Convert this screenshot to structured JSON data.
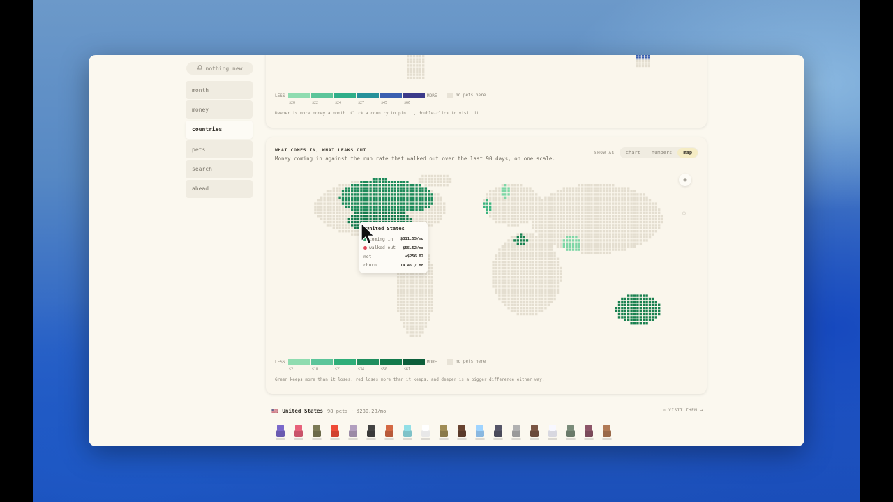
{
  "sidebar": {
    "notice": "nothing new",
    "items": [
      {
        "label": "month"
      },
      {
        "label": "money"
      },
      {
        "label": "countries",
        "active": true
      },
      {
        "label": "pets"
      },
      {
        "label": "search"
      },
      {
        "label": "ahead"
      }
    ]
  },
  "top_card": {
    "legend": {
      "less": "LESS",
      "more": "MORE",
      "colors": [
        "#8fdcb0",
        "#5cc59a",
        "#2fae89",
        "#26919a",
        "#3a5fb0",
        "#3b3a8a"
      ],
      "values": [
        "$20",
        "$22",
        "$24",
        "$27",
        "$45",
        "$66"
      ],
      "none_label": "no pets here"
    },
    "note": "Deeper is more money a month. Click a country to pin it, double-click to visit it."
  },
  "main_card": {
    "title": "WHAT COMES IN, WHAT LEAKS OUT",
    "subtitle": "Money coming in against the run rate that walked out over the last 90 days, on one scale.",
    "show_as_label": "SHOW AS",
    "views": [
      {
        "label": "chart"
      },
      {
        "label": "numbers"
      },
      {
        "label": "map",
        "selected": true
      }
    ],
    "zoom_in": "+",
    "zoom_out": "−",
    "zoom_reset": "○",
    "tooltip": {
      "country": "United States",
      "rows": [
        {
          "label": "coming in",
          "value": "$311.55/mo",
          "dot": "#2f9e6b"
        },
        {
          "label": "walked out",
          "value": "$55.52/mo",
          "dot": "#e0485a"
        },
        {
          "label": "net",
          "value": "+$256.02",
          "dot": ""
        },
        {
          "label": "churn",
          "value": "14.4% / mo",
          "dot": ""
        }
      ]
    },
    "legend": {
      "less": "LESS",
      "more": "MORE",
      "colors": [
        "#8fdcb0",
        "#5cc59a",
        "#2fae79",
        "#1f8e5e",
        "#137a4c",
        "#0c5e3a"
      ],
      "values": [
        "$2",
        "$10",
        "$21",
        "$34",
        "$50",
        "$61"
      ],
      "none_label": "no pets here"
    },
    "note": "Green keeps more than it loses, red loses more than it keeps, and deeper is a bigger difference either way.",
    "map_colors": {
      "land": "#e4ded0",
      "us": "#167a4e",
      "canada": "#1d8a5a",
      "australia": "#1a8150",
      "light": "#7fd6a6",
      "mid": "#3cb47f"
    }
  },
  "bottom": {
    "flag": "🇺🇸",
    "country": "United States",
    "meta": "98 pets · $280.28/mo",
    "visit": "⊙ VISIT THEM →",
    "pets": [
      {
        "icon": "purple-wolf-pet-icon",
        "color": "#6a5bb0"
      },
      {
        "icon": "pink-blob-pet-icon",
        "color": "#c9546a"
      },
      {
        "icon": "soldier-pet-icon",
        "color": "#6b6a4a"
      },
      {
        "icon": "parrot-pet-icon",
        "color": "#d0402f"
      },
      {
        "icon": "snail-pet-icon",
        "color": "#9b8aa6"
      },
      {
        "icon": "ninja-pet-icon",
        "color": "#3a3a3a"
      },
      {
        "icon": "fox-pet-icon",
        "color": "#b85a3a"
      },
      {
        "icon": "ice-golem-pet-icon",
        "color": "#7fc2c8"
      },
      {
        "icon": "chef-pet-icon",
        "color": "#e8e8e8"
      },
      {
        "icon": "owl-pet-icon",
        "color": "#8a7a4a"
      },
      {
        "icon": "samurai-pet-icon",
        "color": "#5a3a2a"
      },
      {
        "icon": "frost-spirit-pet-icon",
        "color": "#8ab8e0"
      },
      {
        "icon": "knight-pet-icon",
        "color": "#4a4a5a"
      },
      {
        "icon": "elephant-pet-icon",
        "color": "#9a9a9a"
      },
      {
        "icon": "bandit-pet-icon",
        "color": "#6a4a3a"
      },
      {
        "icon": "card-pet-icon",
        "color": "#d8d8e0"
      },
      {
        "icon": "zombie-pet-icon",
        "color": "#6a7a6a"
      },
      {
        "icon": "mage-pet-icon",
        "color": "#7a4a5a"
      },
      {
        "icon": "adventurer-pet-icon",
        "color": "#9a6a4a"
      }
    ]
  }
}
